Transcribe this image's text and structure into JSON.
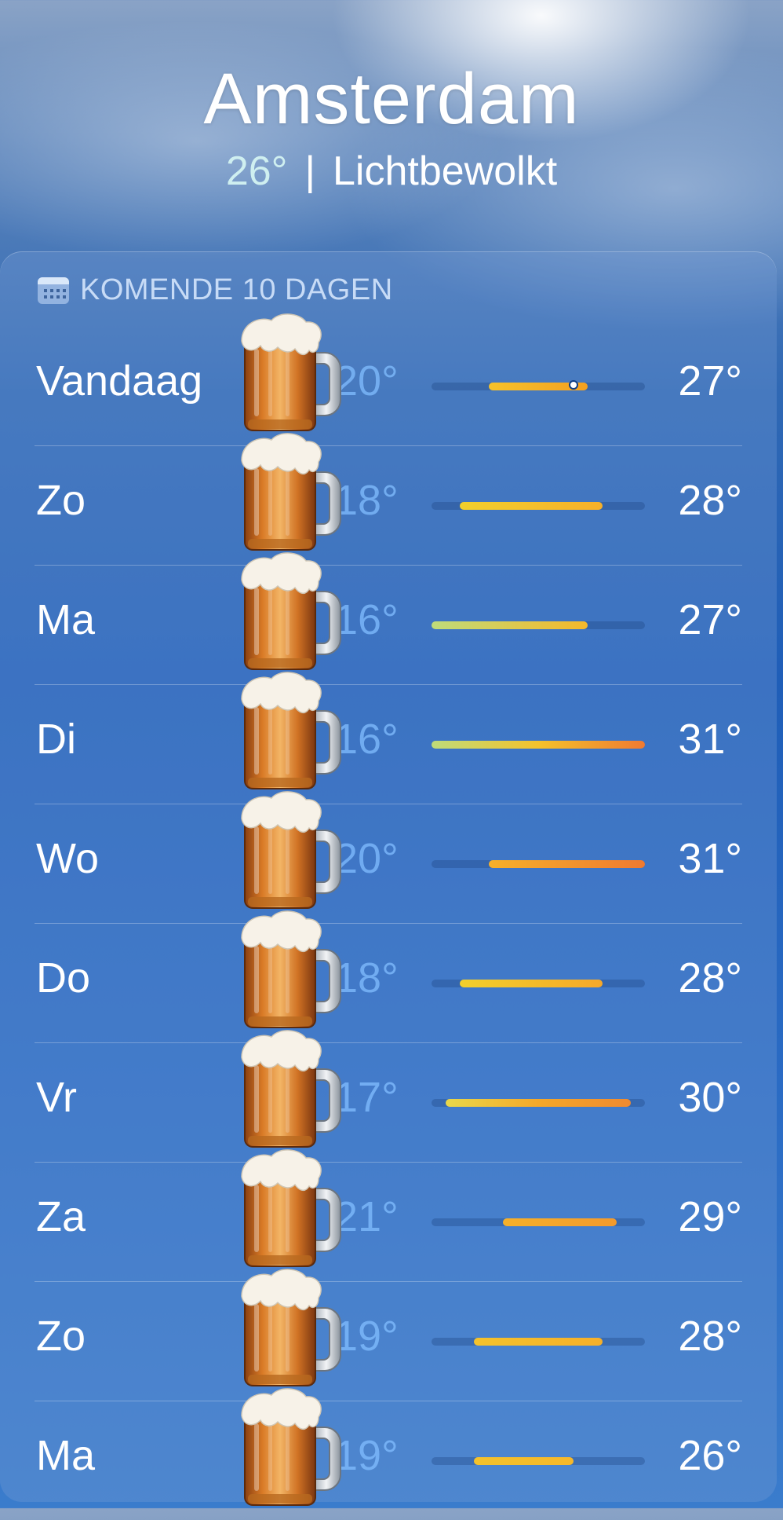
{
  "location": {
    "city": "Amsterdam",
    "current_temp": "26°",
    "separator": "|",
    "condition": "Lichtbewolkt"
  },
  "forecast": {
    "title": "KOMENDE 10 DAGEN",
    "icon": "calendar-icon",
    "weather_icon": "beer-mug-icon",
    "scale": {
      "min": 16,
      "max": 31
    },
    "days": [
      {
        "day": "Vandaag",
        "low": "20°",
        "high": "27°",
        "low_value": 20,
        "high_value": 27,
        "current_value": 26,
        "colors": [
          "#f6c22b",
          "#f4a020"
        ]
      },
      {
        "day": "Zo",
        "low": "18°",
        "high": "28°",
        "low_value": 18,
        "high_value": 28,
        "colors": [
          "#f2d02c",
          "#f6b02a"
        ]
      },
      {
        "day": "Ma",
        "low": "16°",
        "high": "27°",
        "low_value": 16,
        "high_value": 27,
        "colors": [
          "#bfdc7a",
          "#f5b82a"
        ]
      },
      {
        "day": "Di",
        "low": "16°",
        "high": "31°",
        "low_value": 16,
        "high_value": 31,
        "colors": [
          "#bfdc7a",
          "#f4c22c",
          "#f07a30"
        ]
      },
      {
        "day": "Wo",
        "low": "20°",
        "high": "31°",
        "low_value": 20,
        "high_value": 31,
        "colors": [
          "#f6b02a",
          "#f07a30"
        ]
      },
      {
        "day": "Do",
        "low": "18°",
        "high": "28°",
        "low_value": 18,
        "high_value": 28,
        "colors": [
          "#f2d02c",
          "#f6a829"
        ]
      },
      {
        "day": "Vr",
        "low": "17°",
        "high": "30°",
        "low_value": 17,
        "high_value": 30,
        "colors": [
          "#e9d84a",
          "#f5a829",
          "#f08a30"
        ]
      },
      {
        "day": "Za",
        "low": "21°",
        "high": "29°",
        "low_value": 21,
        "high_value": 29,
        "colors": [
          "#f6b02a",
          "#f39a2c"
        ]
      },
      {
        "day": "Zo",
        "low": "19°",
        "high": "28°",
        "low_value": 19,
        "high_value": 28,
        "colors": [
          "#f4c22c",
          "#f6b02a"
        ]
      },
      {
        "day": "Ma",
        "low": "19°",
        "high": "26°",
        "low_value": 19,
        "high_value": 26,
        "colors": [
          "#f4c22c",
          "#f6b82a"
        ]
      }
    ]
  }
}
